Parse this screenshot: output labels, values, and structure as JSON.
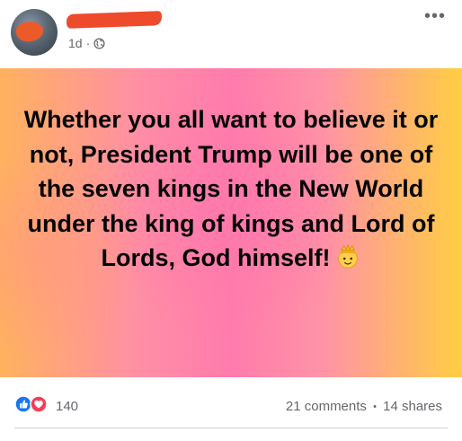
{
  "post": {
    "timestamp": "1d",
    "separator": "·",
    "privacy_icon": "globe-icon",
    "more_label": "•••",
    "text": "Whether you all want to believe it or not, President Trump will be one of the seven kings in the New World under the king of kings and Lord of Lords, God himself!",
    "emoji_icon": "king-emoji-icon"
  },
  "stats": {
    "reactions": [
      "like-icon",
      "love-icon"
    ],
    "reaction_count": "140",
    "comments": "21 comments",
    "dot": "•",
    "shares": "14 shares"
  },
  "colors": {
    "like": "#1877f2",
    "love": "#f33e58",
    "muted_text": "#65676b",
    "redaction": "#ee4a2c"
  }
}
